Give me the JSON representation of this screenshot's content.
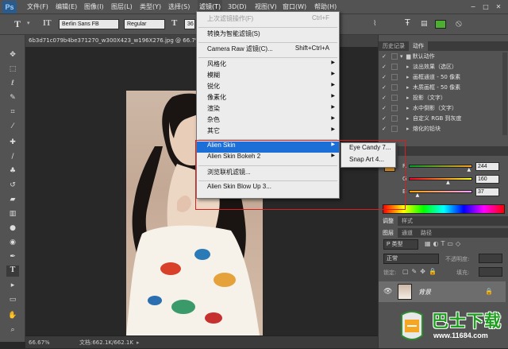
{
  "app": {
    "logo": "Ps"
  },
  "menubar": {
    "items": [
      "文件(F)",
      "编辑(E)",
      "图像(I)",
      "图层(L)",
      "类型(Y)",
      "选择(S)",
      "滤镜(T)",
      "3D(D)",
      "视图(V)",
      "窗口(W)",
      "帮助(H)"
    ],
    "active_index": 6,
    "window_controls": [
      "−",
      "□",
      "✕"
    ]
  },
  "options_bar": {
    "font_family": "Berlin Sans FB",
    "font_style": "Regular",
    "font_size": "36",
    "text_color": "#4caf32"
  },
  "document": {
    "tab_title": "6b3d71c079b4be371270_w300X423_w196X276.jpg @ 66.7%"
  },
  "status": {
    "zoom": "66.67%",
    "doc_size": "文档:662.1K/662.1K"
  },
  "filter_menu": {
    "items": [
      {
        "label": "上次滤镜操作(F)",
        "shortcut": "Ctrl+F",
        "disabled": true
      },
      {
        "separator": true
      },
      {
        "label": "转换为智能滤镜(S)"
      },
      {
        "separator": true
      },
      {
        "label": "Camera Raw 滤镜(C)...",
        "shortcut": "Shift+Ctrl+A"
      },
      {
        "separator": true
      },
      {
        "label": "风格化",
        "submenu": true
      },
      {
        "label": "模糊",
        "submenu": true
      },
      {
        "label": "锐化",
        "submenu": true
      },
      {
        "label": "像素化",
        "submenu": true
      },
      {
        "label": "渲染",
        "submenu": true
      },
      {
        "label": "杂色",
        "submenu": true
      },
      {
        "label": "其它",
        "submenu": true
      },
      {
        "separator": true
      },
      {
        "label": "Alien Skin",
        "submenu": true,
        "highlighted": true
      },
      {
        "label": "Alien Skin Bokeh 2",
        "submenu": true
      },
      {
        "separator": true
      },
      {
        "label": "浏览联机滤镜..."
      },
      {
        "separator": true
      },
      {
        "label": "Alien Skin Blow Up 3..."
      }
    ]
  },
  "submenu": {
    "items": [
      "Eye Candy 7...",
      "Snap Art 4..."
    ]
  },
  "history_panel": {
    "tabs": [
      "历史记录",
      "动作"
    ],
    "active_tab": 1,
    "set_name": "默认动作",
    "actions": [
      "淡出效果（选区）",
      "画框通道 - 50 像素",
      "木质画框 - 50 像素",
      "投影（文字）",
      "水中倒影（文字）",
      "自定义 RGB 到灰度",
      "熔化的铅块"
    ]
  },
  "color_panel": {
    "tab": "颜色",
    "channels": [
      {
        "label": "R",
        "value": "244",
        "fraction": 0.957
      },
      {
        "label": "G",
        "value": "160",
        "fraction": 0.627
      },
      {
        "label": "B",
        "value": "37",
        "fraction": 0.145
      }
    ],
    "foreground_color": "#f4a025"
  },
  "swatches_panel": {
    "tabs": [
      "调整",
      "样式"
    ]
  },
  "layers_panel": {
    "tabs": [
      "图层",
      "通道",
      "路径"
    ],
    "filter_label": "P 类型",
    "blend_mode": "正常",
    "opacity_label": "不透明度:",
    "lock_label": "锁定:",
    "fill_label": "填充:",
    "layer_name": "背景"
  },
  "watermark": {
    "text": "巴士下载",
    "url": "www.11684.com"
  },
  "colors": {
    "accent": "#1c6fd6",
    "highlight_box": "#d42020"
  }
}
